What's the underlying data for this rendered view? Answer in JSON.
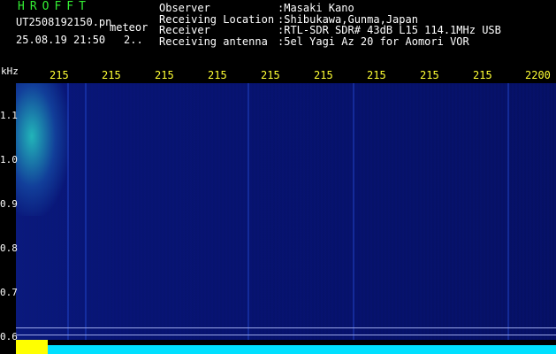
{
  "header": {
    "logo": "HROFFT",
    "filename": "UT2508192150.pn",
    "tag": "meteor",
    "datetime": "25.08.19 21:50",
    "index": "2..",
    "info": [
      {
        "key": "Observer",
        "value": ":Masaki Kano"
      },
      {
        "key": "Receiving Location",
        "value": ":Shibukawa,Gunma,Japan"
      },
      {
        "key": "Receiver",
        "value": ":RTL-SDR SDR# 43dB L15 114.1MHz USB"
      },
      {
        "key": "Receiving antenna",
        "value": ":5el Yagi Az 20 for Aomori VOR"
      }
    ]
  },
  "axis": {
    "unit": "kHz",
    "y_ticks": [
      "1.1",
      "1.0",
      "0.9",
      "0.8",
      "0.7",
      "0.6"
    ],
    "x_ticks": [
      "215",
      "215",
      "215",
      "215",
      "215",
      "215",
      "215",
      "215",
      "215",
      "2200"
    ]
  },
  "colors": {
    "waterfall": "#061268",
    "baseline": "#00e0ff",
    "marker": "#ffff00",
    "ticks": "#ffff33",
    "logo": "#33ee33"
  }
}
